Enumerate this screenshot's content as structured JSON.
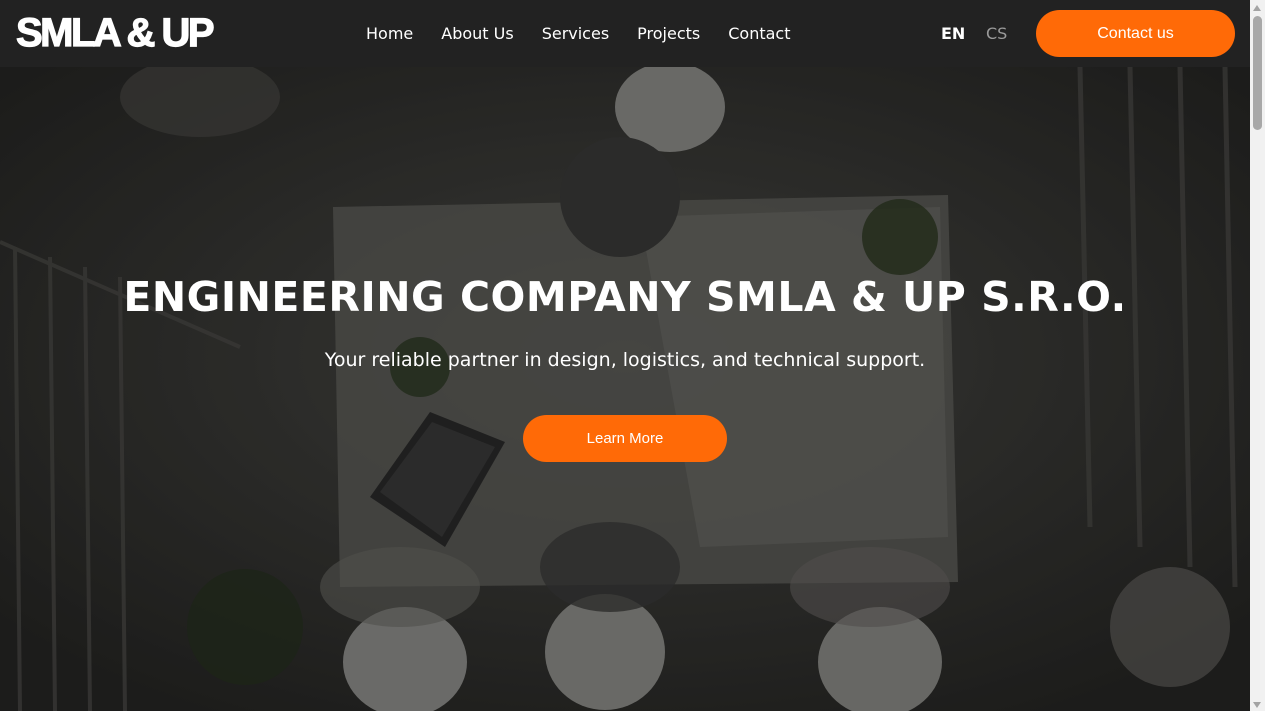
{
  "header": {
    "logo_text": "SMLA & UP",
    "nav": [
      {
        "label": "Home"
      },
      {
        "label": "About Us"
      },
      {
        "label": "Services"
      },
      {
        "label": "Projects"
      },
      {
        "label": "Contact"
      }
    ],
    "languages": {
      "active": "EN",
      "other": "CS"
    },
    "contact_button": "Contact us"
  },
  "hero": {
    "title": "ENGINEERING COMPANY SMLA & UP S.R.O.",
    "subtitle": "Your reliable partner in design, logistics, and technical support.",
    "cta_label": "Learn More",
    "background": "overhead-photo-engineers-hard-hats-table"
  },
  "colors": {
    "accent": "#ff6a07",
    "header_bg": "#222222",
    "text_light": "#ffffff",
    "lang_inactive": "#9a9a9a"
  }
}
